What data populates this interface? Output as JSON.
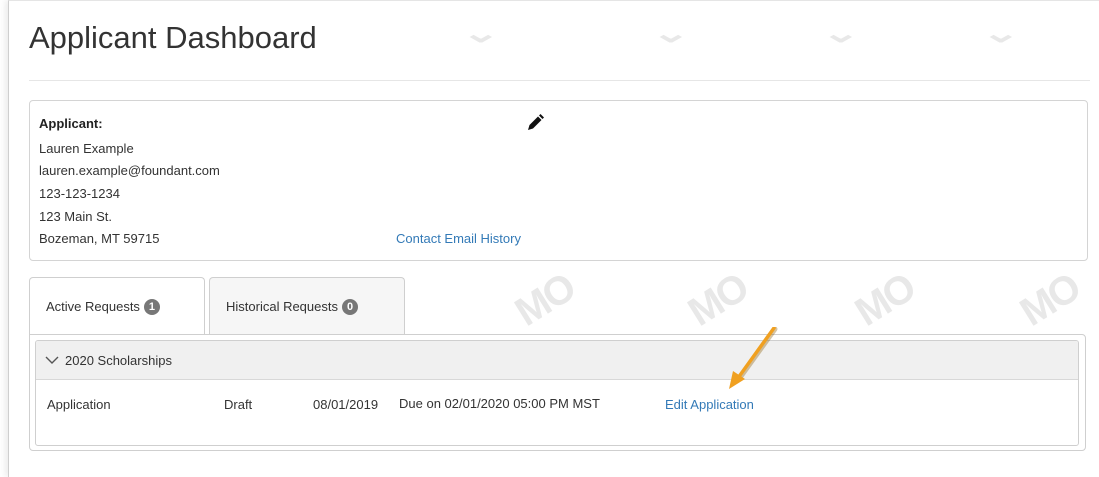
{
  "page": {
    "title": "Applicant Dashboard"
  },
  "applicant": {
    "label": "Applicant:",
    "name": "Lauren Example",
    "email": "lauren.example@foundant.com",
    "phone": "123-123-1234",
    "address": "123 Main St.",
    "city_state_zip": "Bozeman, MT 59715",
    "contact_history_link": "Contact Email History"
  },
  "tabs": [
    {
      "label": "Active Requests",
      "count": "1",
      "active": true
    },
    {
      "label": "Historical Requests",
      "count": "0",
      "active": false
    }
  ],
  "group": {
    "title": "2020 Scholarships",
    "rows": [
      {
        "type": "Application",
        "status": "Draft",
        "date": "08/01/2019",
        "due": "Due on 02/01/2020 05:00 PM MST",
        "action": "Edit Application"
      }
    ]
  },
  "colors": {
    "link": "#337ab7",
    "annotation_arrow": "#f0a020",
    "badge": "#777777"
  },
  "icons": {
    "edit": "pencil-icon",
    "collapse": "chevron-down-icon"
  }
}
